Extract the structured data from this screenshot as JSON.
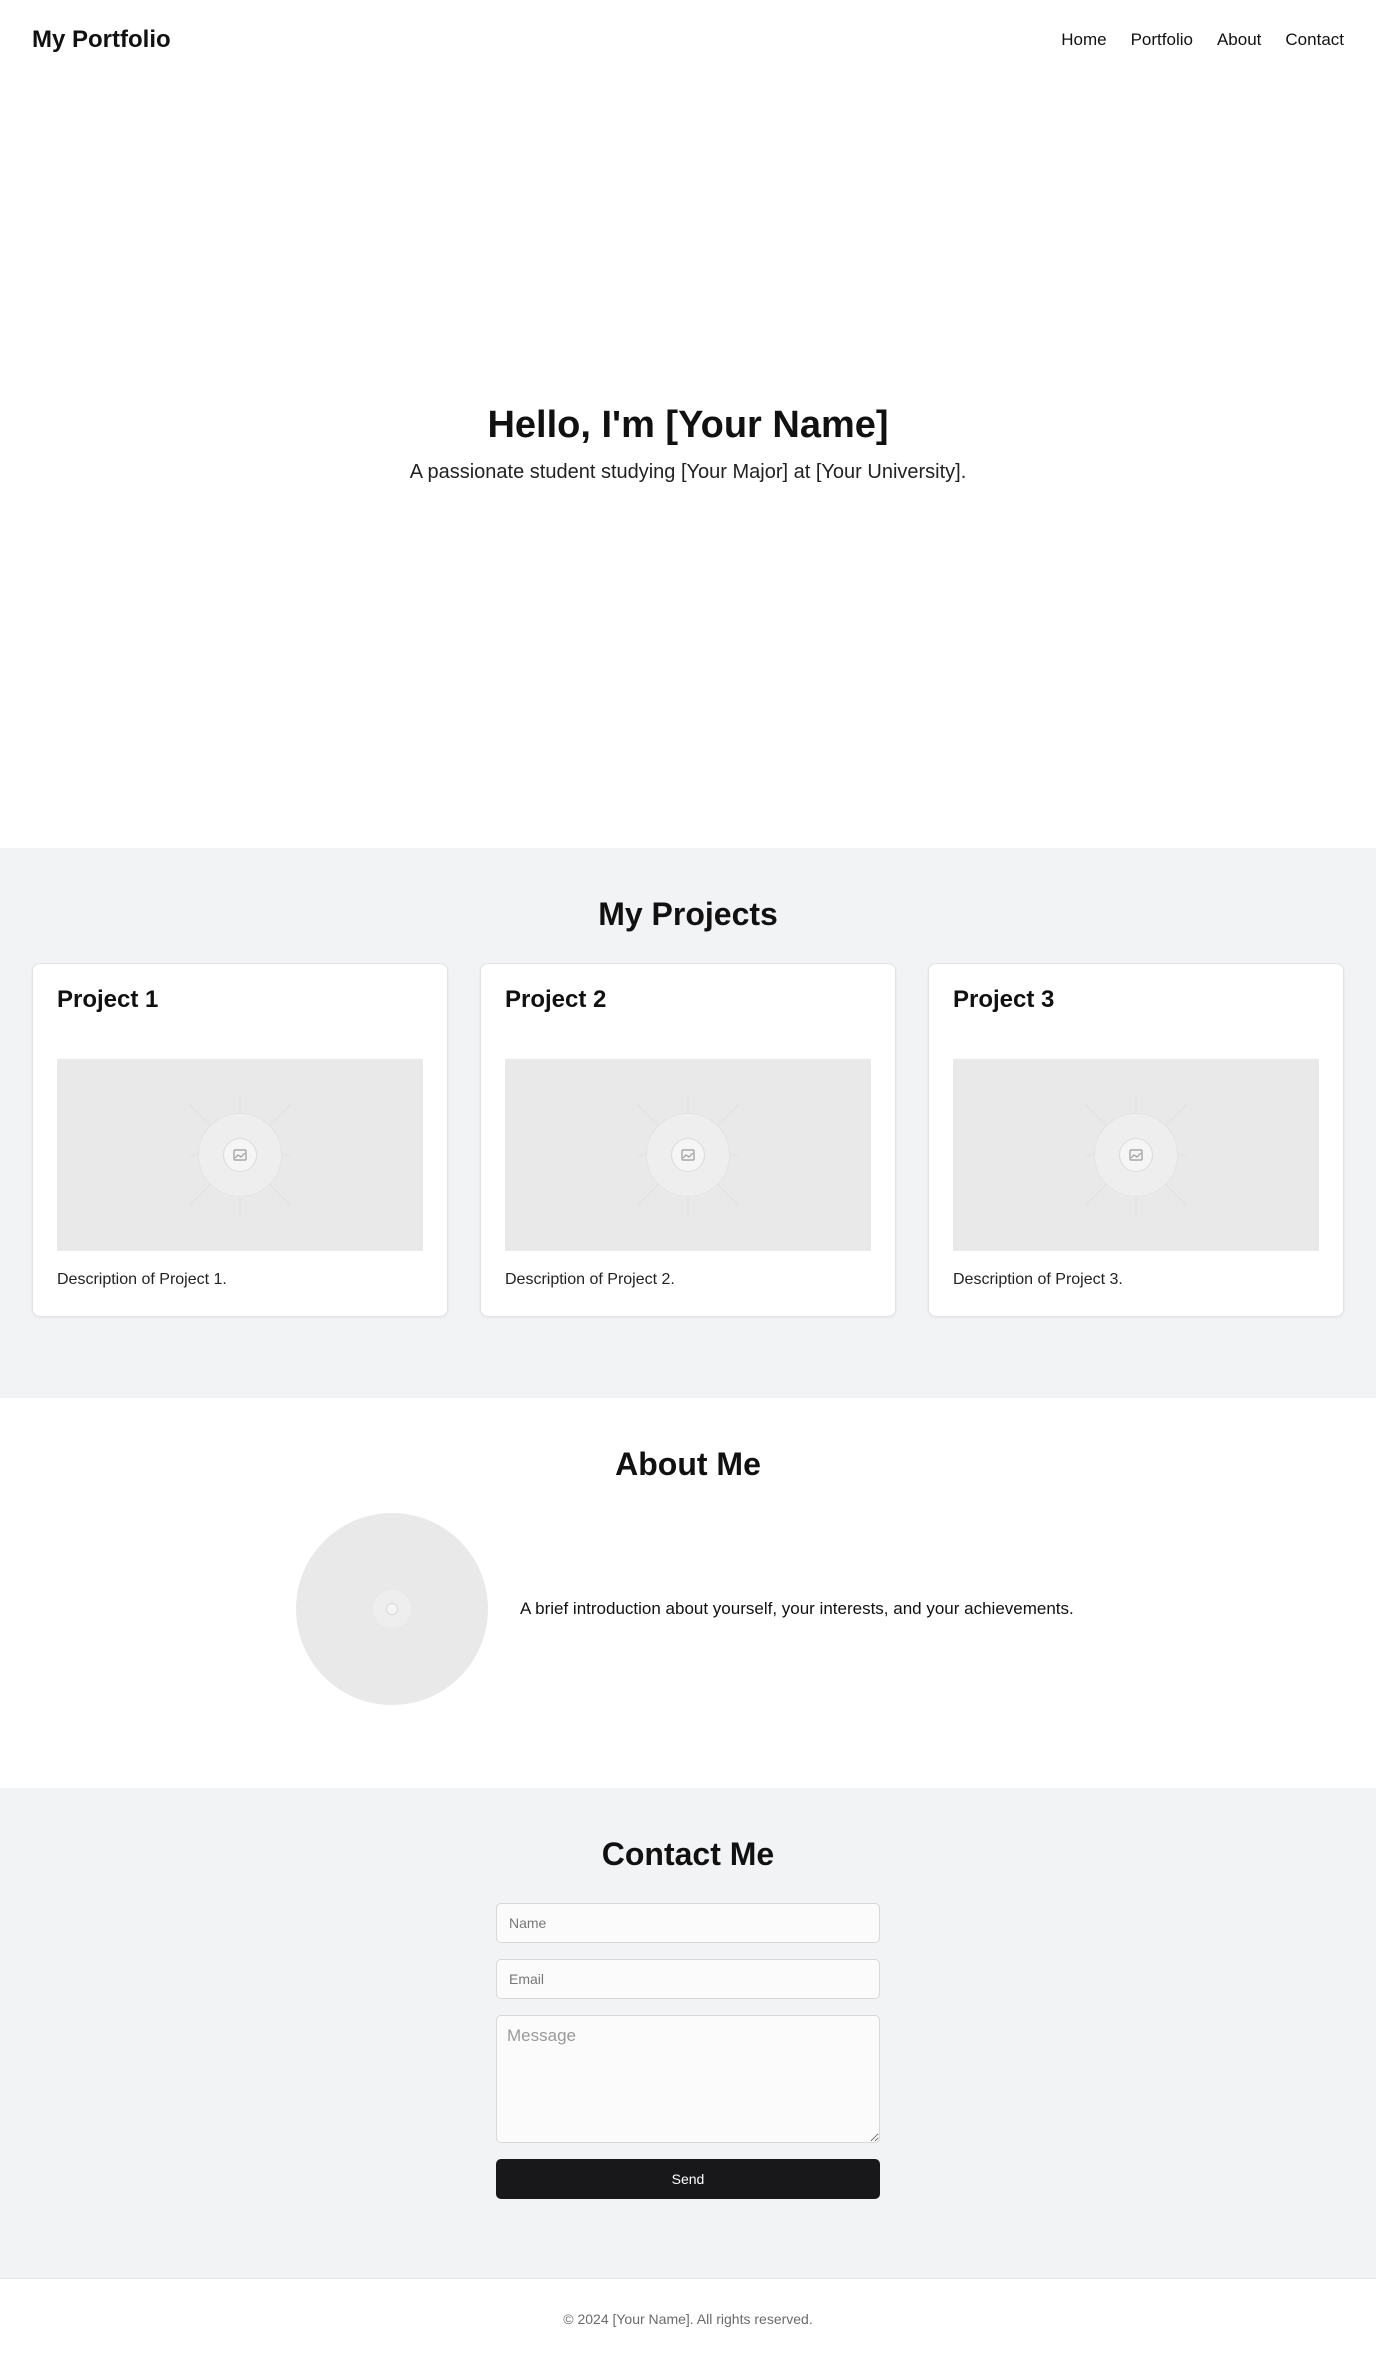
{
  "header": {
    "brand": "My Portfolio",
    "nav": [
      "Home",
      "Portfolio",
      "About",
      "Contact"
    ]
  },
  "hero": {
    "title": "Hello, I'm [Your Name]",
    "subtitle": "A passionate student studying [Your Major] at [Your University]."
  },
  "projects": {
    "title": "My Projects",
    "items": [
      {
        "title": "Project 1",
        "description": "Description of Project 1."
      },
      {
        "title": "Project 2",
        "description": "Description of Project 2."
      },
      {
        "title": "Project 3",
        "description": "Description of Project 3."
      }
    ]
  },
  "about": {
    "title": "About Me",
    "text": "A brief introduction about yourself, your interests, and your achievements."
  },
  "contact": {
    "title": "Contact Me",
    "name_placeholder": "Name",
    "email_placeholder": "Email",
    "message_placeholder": "Message",
    "send_label": "Send"
  },
  "footer": {
    "text": "© 2024 [Your Name]. All rights reserved."
  },
  "icons": {
    "project_image": "image-icon",
    "avatar": "image-icon"
  },
  "colors": {
    "button_bg": "#18181b",
    "section_alt_bg": "#f2f3f5",
    "placeholder_bg": "#e9e9ea"
  }
}
